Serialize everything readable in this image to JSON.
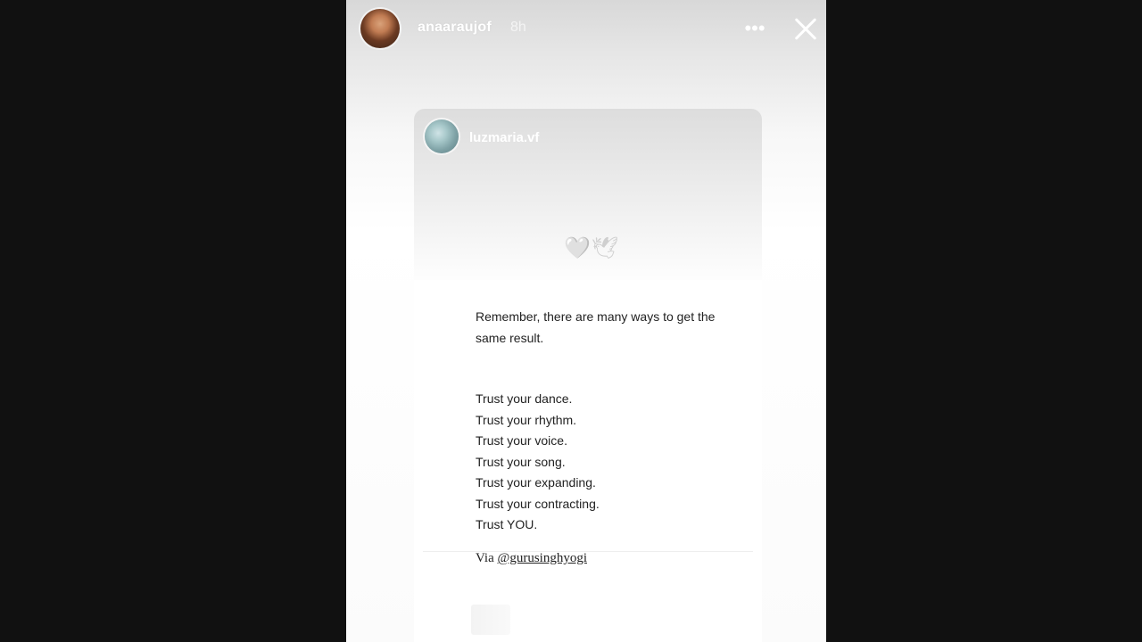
{
  "story": {
    "username": "anaaraujof",
    "timestamp": "8h",
    "more_icon": "more-icon",
    "close_icon": "close-icon"
  },
  "shared_post": {
    "username": "luzmaria.vf",
    "emoji": {
      "heart": "🤍",
      "dove": "🕊"
    },
    "intro": "Remember, there are many ways to get the same result.",
    "trust_lines": [
      "Trust your dance.",
      "Trust your rhythm.",
      "Trust your voice.",
      "Trust your song.",
      "Trust your expanding.",
      "Trust your contracting.",
      "Trust YOU."
    ],
    "via_prefix": "Via",
    "via_handle": "@gurusinghyogi"
  }
}
